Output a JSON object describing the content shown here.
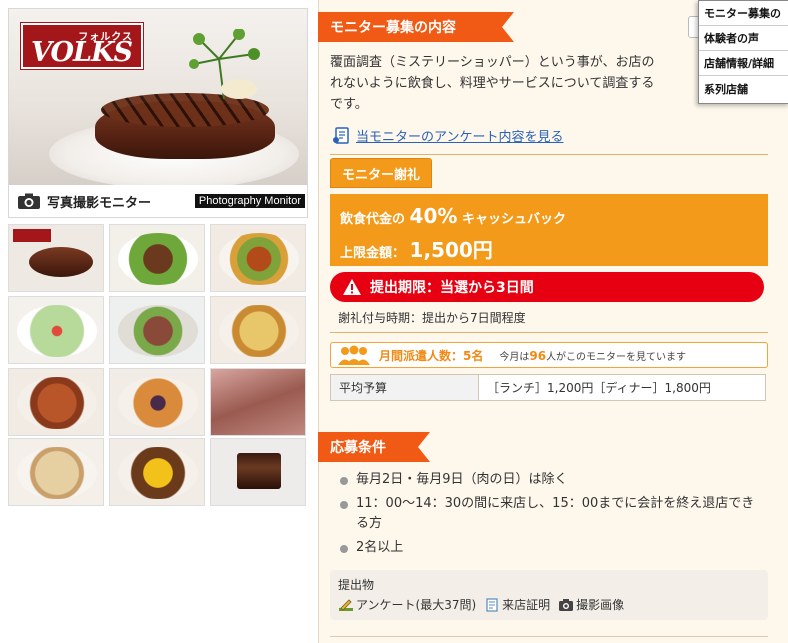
{
  "hero": {
    "logo_kana": "フォルクス",
    "logo_brand": "VOLKS",
    "caption_jp": "写真撮影モニター",
    "caption_en": "Photography Monitor"
  },
  "thumbnails": [
    {
      "name": "thumb-steak"
    },
    {
      "name": "thumb-hamburg-salad"
    },
    {
      "name": "thumb-vegetable-dish"
    },
    {
      "name": "thumb-green-soup"
    },
    {
      "name": "thumb-meat-salad"
    },
    {
      "name": "thumb-gratin"
    },
    {
      "name": "thumb-pasta-tomato"
    },
    {
      "name": "thumb-pasta-eggplant"
    },
    {
      "name": "thumb-roast-beef"
    },
    {
      "name": "thumb-cream-pasta"
    },
    {
      "name": "thumb-omurice"
    },
    {
      "name": "thumb-chocolate-cake"
    }
  ],
  "panel": {
    "section_title": "モニター募集の内容",
    "description_lines": [
      "覆面調査（ミステリーショッパー）という事が、お店の",
      "れないように飲食し、料理やサービスについて調査する",
      "です。"
    ],
    "survey_link": "当モニターのアンケート内容を見る",
    "reward_tab": "モニター謝礼",
    "reward_line1_prefix": "飲食代金の",
    "reward_line1_value": "40%",
    "reward_line1_suffix": "キャッシュバック",
    "reward_line2_prefix": "上限金額：",
    "reward_line2_value": "1,500円",
    "deadline_label": "提出期限：当選から3日間",
    "payment_timing": "謝礼付与時期：提出から7日間程度",
    "visitors_label": "月間派遣人数：5名",
    "visitors_note_prefix": "今月は",
    "visitors_note_count": "96",
    "visitors_note_suffix": "人がこのモニターを見ています",
    "budget_label": "平均予算",
    "budget_value": "［ランチ］1,200円［ディナー］1,800円",
    "conditions_title": "応募条件",
    "conditions": [
      "毎月2日・毎月9日（肉の日）は除く",
      "11：00〜14：30の間に来店し、15：00までに会計を終え退店でき",
      "る方",
      "2名以上"
    ],
    "submit_title": "提出物",
    "submit_items": [
      "アンケート(最大37問)",
      "来店証明",
      "撮影画像"
    ]
  },
  "floatnav": {
    "items": [
      "モニター募集の",
      "体験者の声",
      "店舗情報/詳細",
      "系列店舗"
    ]
  },
  "colors": {
    "ribbon": "#f05a14",
    "reward": "#f39a1a",
    "deadline": "#e60012",
    "link": "#2a62b8",
    "brand_red": "#a3171b"
  }
}
